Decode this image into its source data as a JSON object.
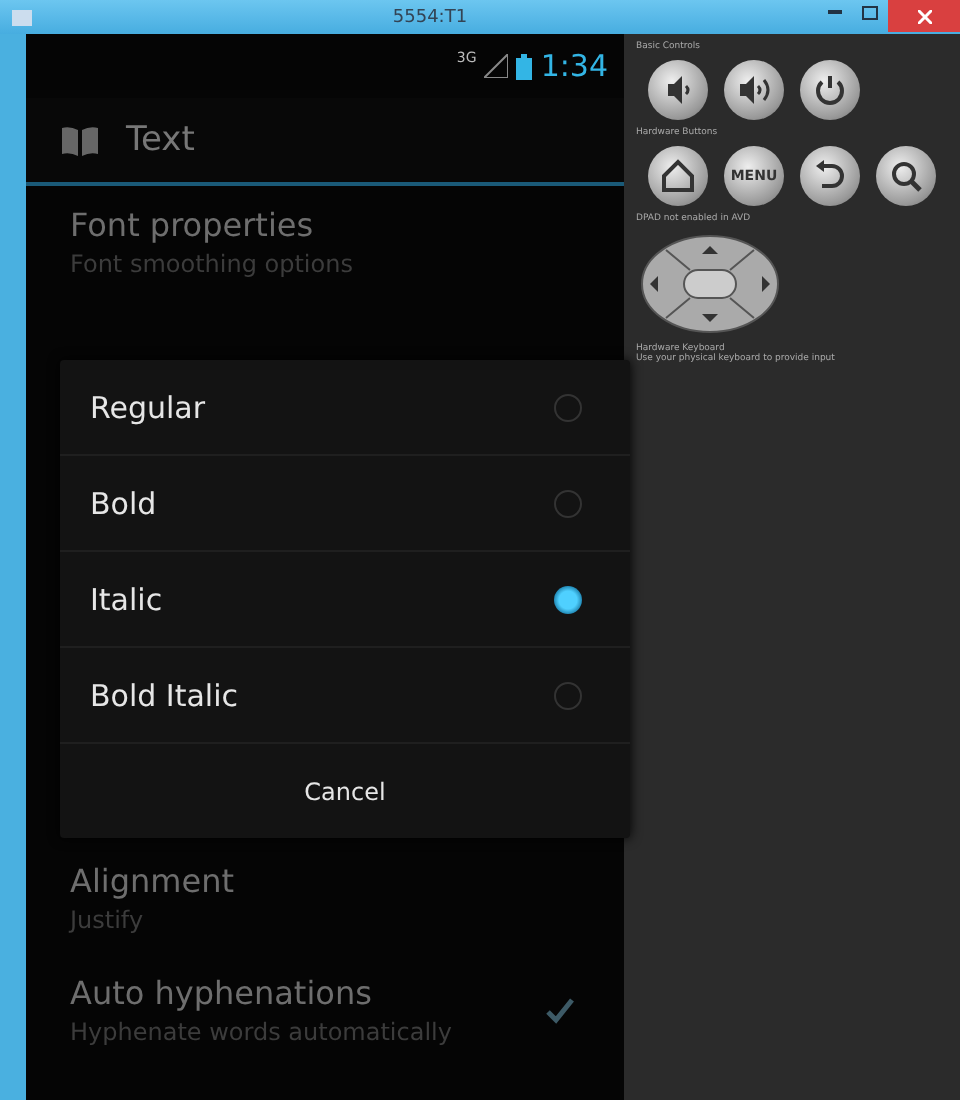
{
  "window": {
    "title": "5554:T1"
  },
  "status_bar": {
    "network": "3G",
    "time": "1:34"
  },
  "action_bar": {
    "title": "Text"
  },
  "preferences": [
    {
      "title": "Font properties",
      "summary": "Font smoothing options",
      "kind": "plain"
    },
    {
      "title": "Alignment",
      "summary": "Justify",
      "kind": "plain"
    },
    {
      "title": "Auto hyphenations",
      "summary": "Hyphenate words automatically",
      "kind": "checkbox",
      "checked": true
    }
  ],
  "dialog": {
    "options": [
      {
        "label": "Regular",
        "selected": false
      },
      {
        "label": "Bold",
        "selected": false
      },
      {
        "label": "Italic",
        "selected": true
      },
      {
        "label": "Bold Italic",
        "selected": false
      }
    ],
    "cancel": "Cancel"
  },
  "emulator_panel": {
    "basic_controls_label": "Basic Controls",
    "basic_controls": [
      {
        "kind": "volume-down"
      },
      {
        "kind": "volume-up"
      },
      {
        "kind": "power"
      }
    ],
    "hardware_buttons_label": "Hardware Buttons",
    "hardware_buttons": [
      {
        "kind": "home"
      },
      {
        "kind": "menu",
        "label": "MENU"
      },
      {
        "kind": "back"
      },
      {
        "kind": "search"
      }
    ],
    "dpad_label": "DPAD not enabled in AVD",
    "keyboard_label": "Hardware Keyboard",
    "keyboard_hint": "Use your physical keyboard to provide input"
  }
}
